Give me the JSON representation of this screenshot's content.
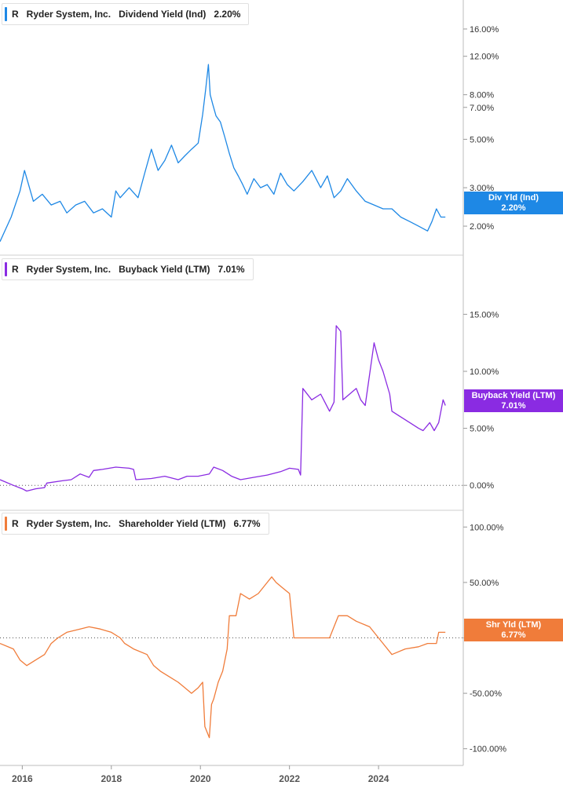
{
  "x_axis": {
    "ticks": [
      "2016",
      "2018",
      "2020",
      "2022",
      "2024"
    ]
  },
  "chart_data": [
    {
      "type": "line",
      "scale": "log",
      "legend": {
        "ticker": "R",
        "company": "Ryder System, Inc.",
        "series": "Dividend Yield (Ind)",
        "value": "2.20%"
      },
      "tag": {
        "label": "Div Yld (Ind)",
        "value": "2.20%"
      },
      "color": "#1e88e5",
      "y_ticks": [
        {
          "label": "16.00%",
          "v": 16
        },
        {
          "label": "12.00%",
          "v": 12
        },
        {
          "label": "8.00%",
          "v": 8
        },
        {
          "label": "7.00%",
          "v": 7
        },
        {
          "label": "5.00%",
          "v": 5
        },
        {
          "label": "3.00%",
          "v": 3
        },
        {
          "label": "2.00%",
          "v": 2
        }
      ],
      "ylim": [
        1.6,
        20
      ],
      "series": [
        {
          "x": [
            2015.5,
            2015.75,
            2015.95,
            2016.05,
            2016.25,
            2016.45,
            2016.65,
            2016.85,
            2017.0,
            2017.2,
            2017.4,
            2017.6,
            2017.8,
            2018.0,
            2018.1,
            2018.2,
            2018.4,
            2018.6,
            2018.75,
            2018.9,
            2019.05,
            2019.2,
            2019.35,
            2019.5,
            2019.65,
            2019.8,
            2019.95,
            2020.05,
            2020.12,
            2020.18,
            2020.22,
            2020.28,
            2020.35,
            2020.45,
            2020.55,
            2020.65,
            2020.75,
            2020.85,
            2020.95,
            2021.05,
            2021.2,
            2021.35,
            2021.5,
            2021.65,
            2021.8,
            2021.95,
            2022.1,
            2022.3,
            2022.5,
            2022.7,
            2022.85,
            2023.0,
            2023.15,
            2023.3,
            2023.5,
            2023.7,
            2023.9,
            2024.1,
            2024.3,
            2024.5,
            2024.7,
            2024.9,
            2025.1,
            2025.2,
            2025.3,
            2025.4,
            2025.5
          ],
          "y": [
            1.7,
            2.2,
            2.9,
            3.6,
            2.6,
            2.8,
            2.5,
            2.6,
            2.3,
            2.5,
            2.6,
            2.3,
            2.4,
            2.2,
            2.9,
            2.7,
            3.0,
            2.7,
            3.5,
            4.5,
            3.6,
            4.0,
            4.7,
            3.9,
            4.2,
            4.5,
            4.8,
            6.5,
            8.5,
            11.0,
            8.0,
            7.2,
            6.4,
            6.0,
            5.1,
            4.3,
            3.7,
            3.4,
            3.1,
            2.8,
            3.3,
            3.0,
            3.1,
            2.8,
            3.5,
            3.1,
            2.9,
            3.2,
            3.6,
            3.0,
            3.4,
            2.7,
            2.9,
            3.3,
            2.9,
            2.6,
            2.5,
            2.4,
            2.4,
            2.2,
            2.1,
            2.0,
            1.9,
            2.1,
            2.4,
            2.2,
            2.2
          ]
        }
      ]
    },
    {
      "type": "line",
      "scale": "linear",
      "legend": {
        "ticker": "R",
        "company": "Ryder System, Inc.",
        "series": "Buyback Yield (LTM)",
        "value": "7.01%"
      },
      "tag": {
        "label": "Buyback Yield (LTM)",
        "value": "7.01%"
      },
      "color": "#8a2be2",
      "y_ticks": [
        {
          "label": "15.00%",
          "v": 15
        },
        {
          "label": "10.00%",
          "v": 10
        },
        {
          "label": "5.00%",
          "v": 5
        },
        {
          "label": "0.00%",
          "v": 0
        }
      ],
      "ylim": [
        -1.5,
        19.5
      ],
      "zero_line": 0,
      "series": [
        {
          "x": [
            2015.5,
            2015.8,
            2016.0,
            2016.1,
            2016.3,
            2016.5,
            2016.55,
            2016.9,
            2017.1,
            2017.3,
            2017.5,
            2017.6,
            2017.8,
            2018.1,
            2018.4,
            2018.5,
            2018.55,
            2018.9,
            2019.2,
            2019.5,
            2019.7,
            2019.95,
            2020.2,
            2020.3,
            2020.5,
            2020.7,
            2020.9,
            2021.2,
            2021.5,
            2021.8,
            2022.0,
            2022.2,
            2022.25,
            2022.3,
            2022.5,
            2022.7,
            2022.9,
            2023.0,
            2023.05,
            2023.15,
            2023.2,
            2023.35,
            2023.5,
            2023.6,
            2023.7,
            2023.9,
            2024.0,
            2024.1,
            2024.25,
            2024.3,
            2024.5,
            2024.7,
            2024.9,
            2025.0,
            2025.15,
            2025.25,
            2025.35,
            2025.45,
            2025.5
          ],
          "y": [
            0.5,
            0.0,
            -0.3,
            -0.5,
            -0.3,
            -0.2,
            0.2,
            0.4,
            0.5,
            1.0,
            0.7,
            1.3,
            1.4,
            1.6,
            1.5,
            1.4,
            0.5,
            0.6,
            0.8,
            0.5,
            0.8,
            0.8,
            1.0,
            1.6,
            1.3,
            0.8,
            0.5,
            0.7,
            0.9,
            1.2,
            1.5,
            1.4,
            0.9,
            8.5,
            7.5,
            8.0,
            6.5,
            7.3,
            14.0,
            13.5,
            7.5,
            8.0,
            8.5,
            7.5,
            7.0,
            12.5,
            11.0,
            10.0,
            8.0,
            6.5,
            6.0,
            5.5,
            5.0,
            4.8,
            5.5,
            4.8,
            5.5,
            7.5,
            7.0
          ]
        }
      ]
    },
    {
      "type": "line",
      "scale": "linear",
      "legend": {
        "ticker": "R",
        "company": "Ryder System, Inc.",
        "series": "Shareholder Yield (LTM)",
        "value": "6.77%"
      },
      "tag": {
        "label": "Shr Yld (LTM)",
        "value": "6.77%"
      },
      "color": "#f07c3a",
      "y_ticks": [
        {
          "label": "100.00%",
          "v": 100
        },
        {
          "label": "50.00%",
          "v": 50
        },
        {
          "label": "0.00%",
          "v": 0
        },
        {
          "label": "-50.00%",
          "v": -50
        },
        {
          "label": "-100.00%",
          "v": -100
        }
      ],
      "ylim": [
        -108,
        108
      ],
      "zero_line": 0,
      "series": [
        {
          "x": [
            2015.5,
            2015.8,
            2015.95,
            2016.1,
            2016.3,
            2016.5,
            2016.65,
            2016.8,
            2017.0,
            2017.3,
            2017.5,
            2017.75,
            2018.0,
            2018.2,
            2018.3,
            2018.5,
            2018.8,
            2018.95,
            2019.1,
            2019.3,
            2019.5,
            2019.65,
            2019.8,
            2019.95,
            2020.05,
            2020.1,
            2020.2,
            2020.25,
            2020.3,
            2020.4,
            2020.5,
            2020.6,
            2020.65,
            2020.8,
            2020.9,
            2021.1,
            2021.3,
            2021.5,
            2021.6,
            2021.7,
            2021.85,
            2022.0,
            2022.1,
            2022.3,
            2022.6,
            2022.9,
            2023.1,
            2023.3,
            2023.5,
            2023.8,
            2024.1,
            2024.3,
            2024.6,
            2024.9,
            2025.1,
            2025.3,
            2025.35,
            2025.5
          ],
          "y": [
            -5,
            -10,
            -20,
            -25,
            -20,
            -15,
            -5,
            0,
            5,
            8,
            10,
            8,
            5,
            0,
            -5,
            -10,
            -15,
            -25,
            -30,
            -35,
            -40,
            -45,
            -50,
            -45,
            -40,
            -80,
            -90,
            -60,
            -55,
            -40,
            -30,
            -10,
            20,
            20,
            40,
            35,
            40,
            50,
            55,
            50,
            45,
            40,
            0,
            0,
            0,
            0,
            20,
            20,
            15,
            10,
            -5,
            -15,
            -10,
            -8,
            -5,
            -5,
            5,
            5
          ]
        }
      ]
    }
  ]
}
